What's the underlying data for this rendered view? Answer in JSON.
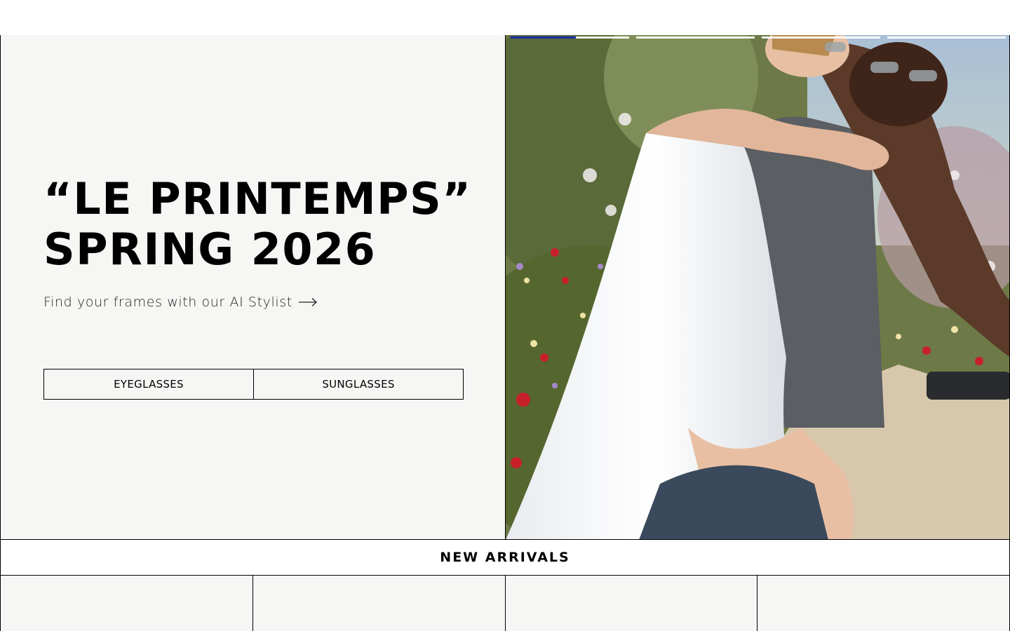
{
  "hero": {
    "title_line1": "“LE PRINTEMPS”",
    "title_line2": "SPRING 2026",
    "stylist_link": "Find your frames with our AI Stylist",
    "buttons": [
      {
        "label": "EYEGLASSES"
      },
      {
        "label": "SUNGLASSES"
      }
    ],
    "slideshow_progress": [
      0.55,
      0.0,
      0.0,
      0.0
    ]
  },
  "new_arrivals": {
    "heading": "NEW ARRIVALS"
  },
  "colors": {
    "background": "#f6f6f4",
    "progress_active": "#1a2fa8",
    "border": "#000000"
  }
}
